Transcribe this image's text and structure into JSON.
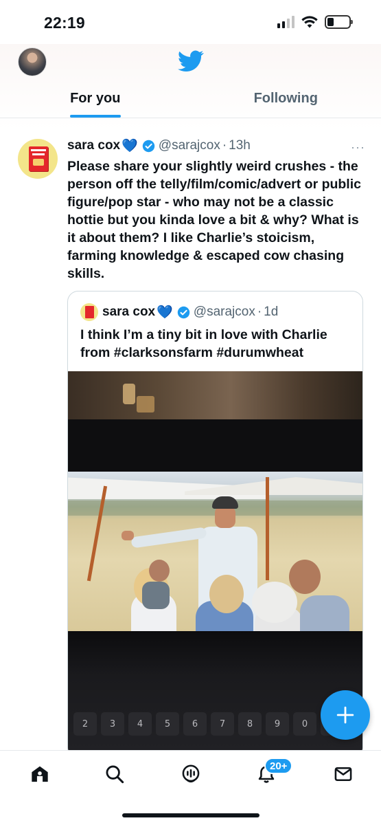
{
  "status_bar": {
    "time": "22:19",
    "icons": [
      "signal-icon",
      "wifi-icon",
      "battery-icon"
    ]
  },
  "header": {
    "logo_icon": "twitter-bird-icon",
    "tabs": [
      {
        "label": "For you",
        "active": true
      },
      {
        "label": "Following",
        "active": false
      }
    ]
  },
  "tweet": {
    "display_name": "sara cox",
    "name_emoji": "💙",
    "verified": true,
    "handle": "@sarajcox",
    "separator": "·",
    "time": "13h",
    "more": "···",
    "text": "Please share your slightly weird crushes - the person off the telly/film/comic/advert or public figure/pop star - who may not be a classic hottie but you kinda love a bit & why? What is it about them? I like Charlie’s stoicism, farming knowledge & escaped cow chasing skills.",
    "quote": {
      "display_name": "sara cox",
      "name_emoji": "💙",
      "verified": true,
      "handle": "@sarajcox",
      "separator": "·",
      "time": "1d",
      "text": "I think I’m a tiny bit in love with Charlie from #clarksonsfarm #durumwheat"
    }
  },
  "fab": {
    "icon": "compose-plus-icon"
  },
  "bottom_nav": {
    "items": [
      "home-icon",
      "search-icon",
      "spaces-icon",
      "notifications-icon",
      "messages-icon"
    ],
    "notifications_badge": "20+"
  },
  "colors": {
    "accent": "#1d9bf0",
    "text_primary": "#0f1419",
    "text_secondary": "#536471"
  }
}
